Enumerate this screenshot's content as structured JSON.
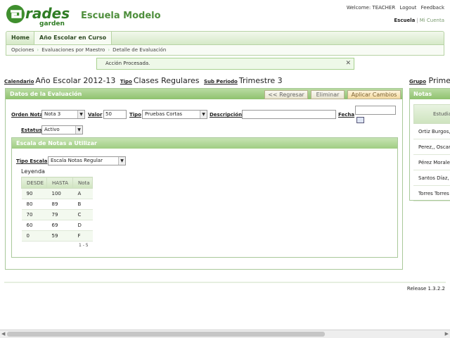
{
  "header": {
    "logo_main": "Grades",
    "logo_sub": "garden",
    "school_name": "Escuela Modelo",
    "welcome": "Welcome: TEACHER",
    "logout": "Logout",
    "feedback": "Feedback",
    "account_school": "Escuela",
    "account_mine": "Mi Cuenta"
  },
  "nav": {
    "home": "Home",
    "active_tab": "Año Escolar en Curso"
  },
  "breadcrumb": [
    "Opciones",
    "Evaluaciones por Maestro",
    "Detalle de Evaluación"
  ],
  "message": "Acción Procesada.",
  "filters": {
    "calendario_label": "Calendario",
    "calendario_value": "Año Escolar 2012-13",
    "tipo_label": "Tipo",
    "tipo_value": "Clases Regulares",
    "subperiodo_label": "Sub Periodo",
    "subperiodo_value": "Trimestre 3",
    "grupo_label": "Grupo",
    "grupo_value": "Primer"
  },
  "evaluation": {
    "title": "Datos de la Evaluación",
    "btn_back": "<< Regresar",
    "btn_delete": "Eliminar",
    "btn_apply": "Aplicar Cambios",
    "orden_label": "Orden Nota",
    "orden_value": "Nota 3",
    "valor_label": "Valor",
    "valor_value": "50",
    "tipo_label": "Tipo",
    "tipo_value": "Pruebas Cortas",
    "descripcion_label": "Descripción",
    "descripcion_value": "",
    "fecha_label": "Fecha",
    "fecha_value": "",
    "estatus_label": "Estatus",
    "estatus_value": "Activo"
  },
  "scale": {
    "title": "Escala de Notas a Utilizar",
    "tipo_label": "Tipo Escala",
    "tipo_value": "Escala Notas Regular",
    "legend": "Leyenda",
    "headers": [
      "DESDE",
      "HASTA",
      "Nota"
    ],
    "rows": [
      [
        "90",
        "100",
        "A"
      ],
      [
        "80",
        "89",
        "B"
      ],
      [
        "70",
        "79",
        "C"
      ],
      [
        "60",
        "69",
        "D"
      ],
      [
        "0",
        "59",
        "F"
      ]
    ],
    "pager": "1 - 5"
  },
  "notas": {
    "title": "Notas",
    "column": "Estudia",
    "students": [
      "Ortiz Burgos,",
      "Perez,, Oscar",
      "Pérez Morale",
      "Santos Díaz,",
      "Torres Torres"
    ]
  },
  "footer": {
    "release": "Release 1.3.2.2"
  }
}
